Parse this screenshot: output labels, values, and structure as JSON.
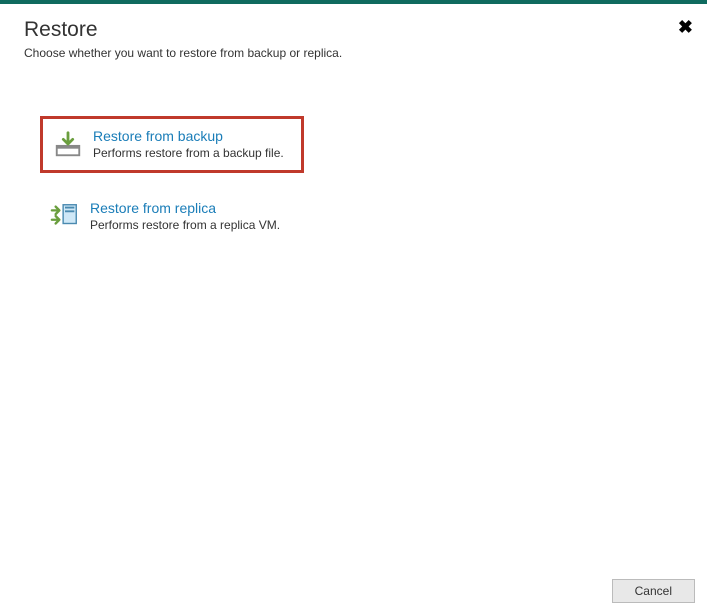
{
  "header": {
    "title": "Restore",
    "subtitle": "Choose whether you want to restore from backup or replica."
  },
  "options": [
    {
      "title": "Restore from backup",
      "description": "Performs restore from a backup file.",
      "highlighted": true
    },
    {
      "title": "Restore from replica",
      "description": "Performs restore from a replica VM.",
      "highlighted": false
    }
  ],
  "footer": {
    "cancel_label": "Cancel"
  }
}
